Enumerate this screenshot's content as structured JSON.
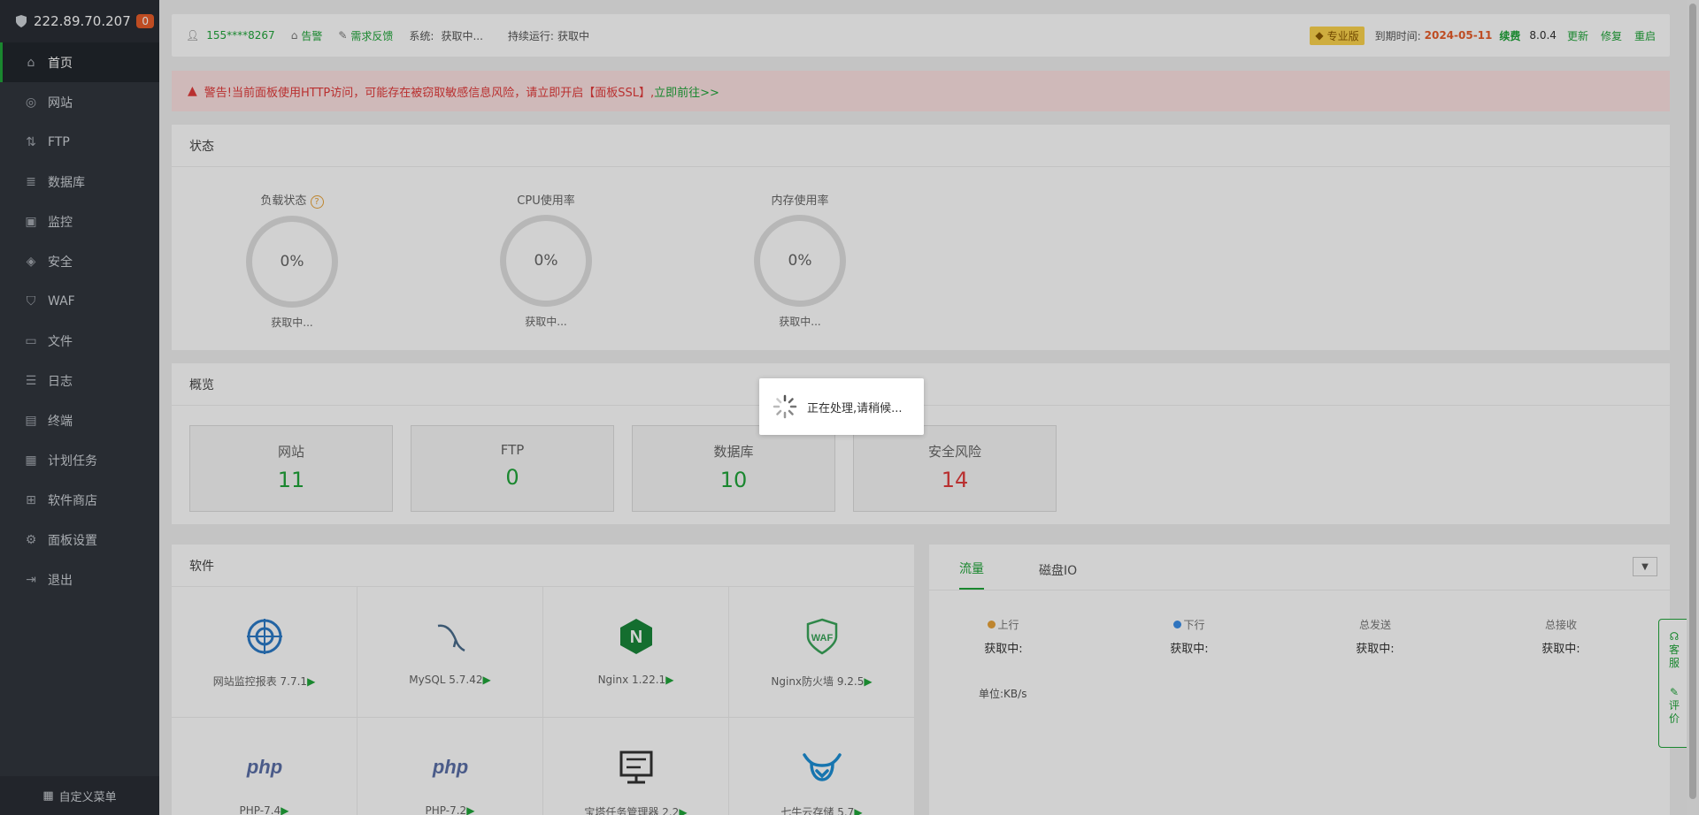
{
  "sidebar": {
    "server_ip": "222.89.70.207",
    "badge_count": "0",
    "items": [
      {
        "label": "首页",
        "icon": "home-icon"
      },
      {
        "label": "网站",
        "icon": "globe-icon"
      },
      {
        "label": "FTP",
        "icon": "ftp-icon"
      },
      {
        "label": "数据库",
        "icon": "database-icon"
      },
      {
        "label": "监控",
        "icon": "monitor-icon"
      },
      {
        "label": "安全",
        "icon": "shield-icon"
      },
      {
        "label": "WAF",
        "icon": "waf-icon"
      },
      {
        "label": "文件",
        "icon": "folder-icon"
      },
      {
        "label": "日志",
        "icon": "log-icon"
      },
      {
        "label": "终端",
        "icon": "terminal-icon"
      },
      {
        "label": "计划任务",
        "icon": "calendar-icon"
      },
      {
        "label": "软件商店",
        "icon": "apps-icon"
      },
      {
        "label": "面板设置",
        "icon": "gear-icon"
      },
      {
        "label": "退出",
        "icon": "logout-icon"
      }
    ],
    "custom_menu": "自定义菜单"
  },
  "topbar": {
    "user": "155****8267",
    "alarm": "告警",
    "feedback": "需求反馈",
    "system_label": "系统:",
    "system_value": "获取中...",
    "uptime_label": "持续运行:",
    "uptime_value": "获取中",
    "pro": "专业版",
    "expire_label": "到期时间:",
    "expire_date": "2024-05-11",
    "renew": "续费",
    "version": "8.0.4",
    "update": "更新",
    "repair": "修复",
    "restart": "重启"
  },
  "warning": {
    "text": "警告!当前面板使用HTTP访问，可能存在被窃取敏感信息风险，请立即开启【面板SSL】,",
    "link": "立即前往>>"
  },
  "status": {
    "title": "状态",
    "gauges": [
      {
        "label": "负载状态",
        "value": "0%",
        "status": "获取中..."
      },
      {
        "label": "CPU使用率",
        "value": "0%",
        "status": "获取中..."
      },
      {
        "label": "内存使用率",
        "value": "0%",
        "status": "获取中..."
      }
    ]
  },
  "overview": {
    "title": "概览",
    "cards": [
      {
        "label": "网站",
        "value": "11"
      },
      {
        "label": "FTP",
        "value": "0"
      },
      {
        "label": "数据库",
        "value": "10"
      },
      {
        "label": "安全风险",
        "value": "14"
      }
    ]
  },
  "software": {
    "title": "软件",
    "items": [
      {
        "name": "网站监控报表 7.7.1",
        "icon": "monitor-report-icon"
      },
      {
        "name": "MySQL 5.7.42",
        "icon": "mysql-icon"
      },
      {
        "name": "Nginx 1.22.1",
        "icon": "nginx-icon"
      },
      {
        "name": "Nginx防火墙 9.2.5",
        "icon": "waf-shield-icon"
      },
      {
        "name": "PHP-7.4",
        "icon": "php-icon"
      },
      {
        "name": "PHP-7.2",
        "icon": "php-icon"
      },
      {
        "name": "宝塔任务管理器 2.2",
        "icon": "task-manager-icon"
      },
      {
        "name": "七牛云存储 5.7",
        "icon": "qiniu-icon"
      }
    ],
    "play": "▶"
  },
  "traffic": {
    "tabs": [
      "流量",
      "磁盘IO"
    ],
    "cols": [
      {
        "label": "上行",
        "value": "获取中:",
        "dot": "#e8a33a"
      },
      {
        "label": "下行",
        "value": "获取中:",
        "dot": "#3a8ee8"
      },
      {
        "label": "总发送",
        "value": "获取中:"
      },
      {
        "label": "总接收",
        "value": "获取中:"
      }
    ],
    "unit": "单位:KB/s"
  },
  "loader": {
    "text": "正在处理,请稍候..."
  },
  "float": {
    "service": [
      "客",
      "服"
    ],
    "review": [
      "评",
      "价"
    ]
  },
  "colors": {
    "accent": "#20a53a",
    "danger": "#e23b3b",
    "sidebar": "#31363e"
  }
}
